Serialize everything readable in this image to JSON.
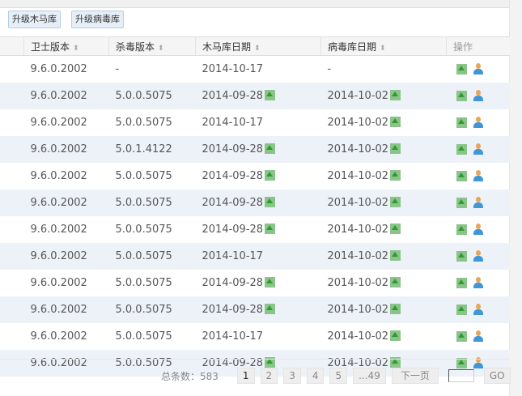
{
  "toolbar": {
    "upgrade_trojan": "升级木马库",
    "upgrade_virus": "升级病毒库"
  },
  "columns": [
    "卫士版本",
    "杀毒版本",
    "木马库日期",
    "病毒库日期",
    "操作"
  ],
  "rows": [
    {
      "guard": "9.6.0.2002",
      "av": "-",
      "trojan": "2014-10-17",
      "trojan_up": false,
      "virus": "-",
      "virus_up": false
    },
    {
      "guard": "9.6.0.2002",
      "av": "5.0.0.5075",
      "trojan": "2014-09-28",
      "trojan_up": true,
      "virus": "2014-10-02",
      "virus_up": true
    },
    {
      "guard": "9.6.0.2002",
      "av": "5.0.0.5075",
      "trojan": "2014-10-17",
      "trojan_up": false,
      "virus": "2014-10-02",
      "virus_up": true
    },
    {
      "guard": "9.6.0.2002",
      "av": "5.0.1.4122",
      "trojan": "2014-09-28",
      "trojan_up": true,
      "virus": "2014-10-02",
      "virus_up": true
    },
    {
      "guard": "9.6.0.2002",
      "av": "5.0.0.5075",
      "trojan": "2014-09-28",
      "trojan_up": true,
      "virus": "2014-10-02",
      "virus_up": true
    },
    {
      "guard": "9.6.0.2002",
      "av": "5.0.0.5075",
      "trojan": "2014-09-28",
      "trojan_up": true,
      "virus": "2014-10-02",
      "virus_up": true
    },
    {
      "guard": "9.6.0.2002",
      "av": "5.0.0.5075",
      "trojan": "2014-09-28",
      "trojan_up": true,
      "virus": "2014-10-02",
      "virus_up": true
    },
    {
      "guard": "9.6.0.2002",
      "av": "5.0.0.5075",
      "trojan": "2014-10-17",
      "trojan_up": false,
      "virus": "2014-10-02",
      "virus_up": true
    },
    {
      "guard": "9.6.0.2002",
      "av": "5.0.0.5075",
      "trojan": "2014-09-28",
      "trojan_up": true,
      "virus": "2014-10-02",
      "virus_up": true
    },
    {
      "guard": "9.6.0.2002",
      "av": "5.0.0.5075",
      "trojan": "2014-09-28",
      "trojan_up": true,
      "virus": "2014-10-02",
      "virus_up": true
    },
    {
      "guard": "9.6.0.2002",
      "av": "5.0.0.5075",
      "trojan": "2014-10-17",
      "trojan_up": false,
      "virus": "2014-10-02",
      "virus_up": true
    },
    {
      "guard": "9.6.0.2002",
      "av": "5.0.0.5075",
      "trojan": "2014-09-28",
      "trojan_up": true,
      "virus": "2014-10-02",
      "virus_up": true
    }
  ],
  "pager": {
    "total": "总条数：583",
    "pages": [
      "1",
      "2",
      "3",
      "4",
      "5",
      "...49"
    ],
    "next": "下一页",
    "go": "GO"
  }
}
